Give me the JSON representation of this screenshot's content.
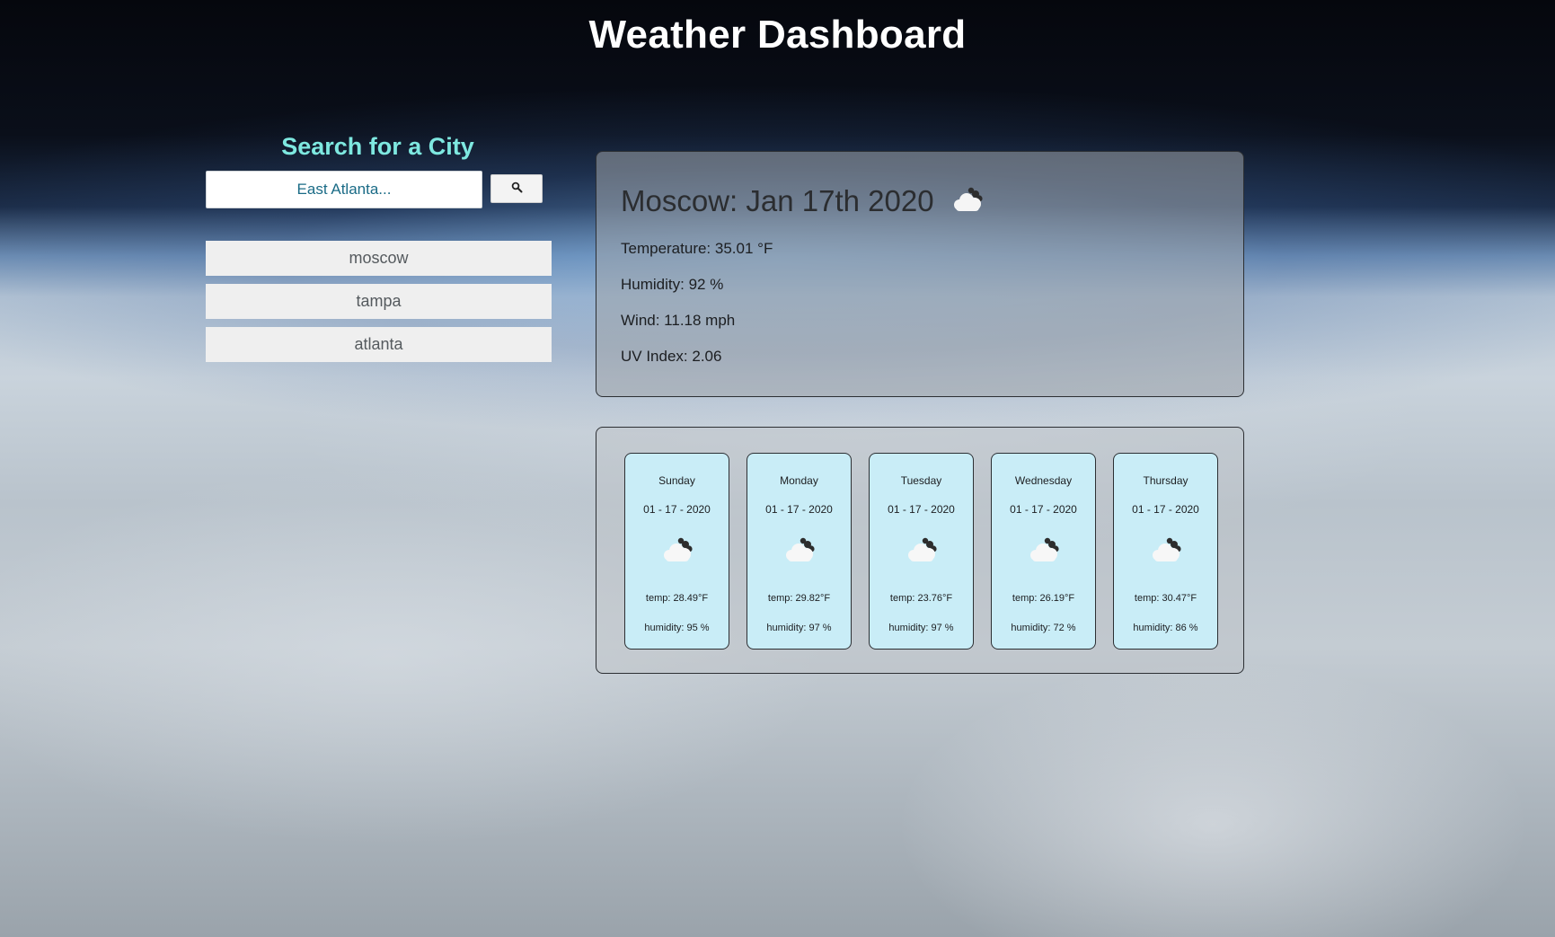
{
  "header": {
    "title": "Weather Dashboard"
  },
  "search": {
    "heading": "Search for a City",
    "placeholder": "East Atlanta...",
    "button_icon": "search-icon"
  },
  "history": [
    "moscow",
    "tampa",
    "atlanta"
  ],
  "current": {
    "heading": "Moscow: Jan 17th 2020",
    "icon": "cloud-icon",
    "temperature": "Temperature: 35.01 °F",
    "humidity": "Humidity: 92 %",
    "wind": "Wind: 11.18 mph",
    "uv": "UV Index: 2.06"
  },
  "forecast": [
    {
      "day": "Sunday",
      "date": "01 - 17 - 2020",
      "icon": "cloud-icon",
      "temp": "temp: 28.49°F",
      "humidity": "humidity: 95 %"
    },
    {
      "day": "Monday",
      "date": "01 - 17 - 2020",
      "icon": "cloud-icon",
      "temp": "temp: 29.82°F",
      "humidity": "humidity: 97 %"
    },
    {
      "day": "Tuesday",
      "date": "01 - 17 - 2020",
      "icon": "cloud-icon",
      "temp": "temp: 23.76°F",
      "humidity": "humidity: 97 %"
    },
    {
      "day": "Wednesday",
      "date": "01 - 17 - 2020",
      "icon": "cloud-icon",
      "temp": "temp: 26.19°F",
      "humidity": "humidity: 72 %"
    },
    {
      "day": "Thursday",
      "date": "01 - 17 - 2020",
      "icon": "cloud-icon",
      "temp": "temp: 30.47°F",
      "humidity": "humidity: 86 %"
    }
  ],
  "colors": {
    "heading_accent": "#7ee8e0",
    "card_background": "#c9edf7",
    "input_text": "#1a6b86"
  }
}
